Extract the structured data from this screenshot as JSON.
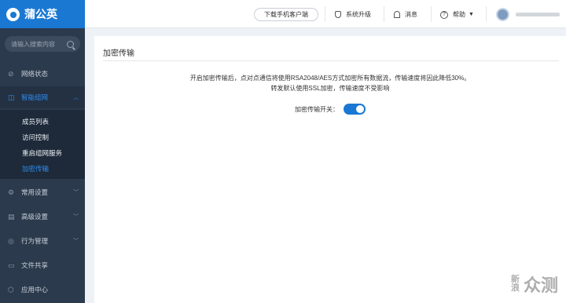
{
  "app": {
    "name": "蒲公英"
  },
  "sidebar": {
    "search_placeholder": "请输入搜索内容",
    "items": [
      {
        "label": "网络状态",
        "icon": "network-icon"
      },
      {
        "label": "智能组网",
        "icon": "mesh-icon",
        "expanded": true,
        "children": [
          "成员列表",
          "访问控制",
          "重启组网服务",
          "加密传输"
        ],
        "active_child": "加密传输"
      },
      {
        "label": "常用设置",
        "icon": "gear-icon"
      },
      {
        "label": "高级设置",
        "icon": "advanced-icon"
      },
      {
        "label": "行为管理",
        "icon": "behavior-icon"
      },
      {
        "label": "文件共享",
        "icon": "folder-icon"
      },
      {
        "label": "应用中心",
        "icon": "app-center-icon"
      }
    ]
  },
  "header": {
    "download_label": "下载手机客户端",
    "upgrade_label": "系统升级",
    "message_label": "消息",
    "help_label": "帮助"
  },
  "main": {
    "title": "加密传输",
    "description_line1": "开启加密传输后，点对点通信将使用RSA2048/AES方式加密所有数据流，传输速度将因此降低30%。",
    "description_line2": "转发默认使用SSL加密，传输速度不受影响",
    "toggle_label": "加密传输开关：",
    "toggle_on": true
  },
  "watermark": {
    "small": "新浪",
    "large": "众测"
  },
  "colors": {
    "brand": "#1a78d3",
    "sidebar_bg": "#2b3a4c",
    "active": "#2d8cf0"
  }
}
